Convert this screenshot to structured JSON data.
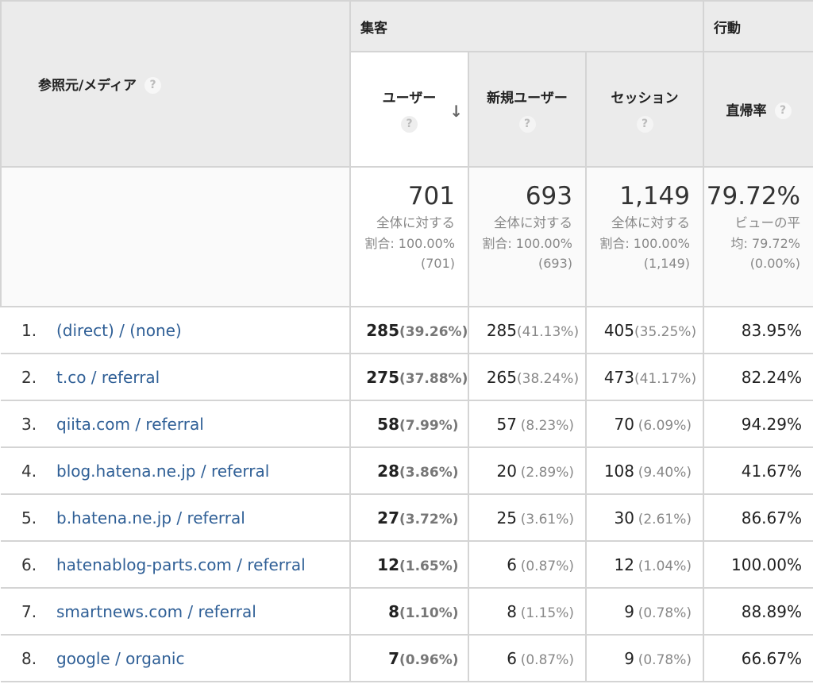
{
  "groups": {
    "acquisition": "集客",
    "behavior": "行動"
  },
  "headers": {
    "dimension": "参照元/メディア",
    "users": "ユーザー",
    "new_users": "新規ユーザー",
    "sessions": "セッション",
    "bounce_rate": "直帰率",
    "help_glyph": "?",
    "sort_glyph": "↓"
  },
  "summary": {
    "users": {
      "total": "701",
      "l1": "全体に対する",
      "l2": "割合: 100.00%",
      "l3": "(701)"
    },
    "new_users": {
      "total": "693",
      "l1": "全体に対する",
      "l2": "割合: 100.00%",
      "l3": "(693)"
    },
    "sessions": {
      "total": "1,149",
      "l1": "全体に対する",
      "l2": "割合: 100.00%",
      "l3": "(1,149)"
    },
    "bounce_rate": {
      "total": "79.72%",
      "l1": "ビューの平",
      "l2": "均: 79.72%",
      "l3": "(0.00%)"
    }
  },
  "rows": [
    {
      "idx": "1.",
      "source": "(direct) / (none)",
      "users": "285",
      "users_pct": "(39.26%)",
      "new_users": "285",
      "new_users_pct": "(41.13%)",
      "sessions": "405",
      "sessions_pct": "(35.25%)",
      "bounce": "83.95%"
    },
    {
      "idx": "2.",
      "source": "t.co / referral",
      "users": "275",
      "users_pct": "(37.88%)",
      "new_users": "265",
      "new_users_pct": "(38.24%)",
      "sessions": "473",
      "sessions_pct": "(41.17%)",
      "bounce": "82.24%"
    },
    {
      "idx": "3.",
      "source": "qiita.com / referral",
      "users": "58",
      "users_pct": "(7.99%)",
      "new_users": "57",
      "new_users_pct": "(8.23%)",
      "sessions": "70",
      "sessions_pct": "(6.09%)",
      "bounce": "94.29%"
    },
    {
      "idx": "4.",
      "source": "blog.hatena.ne.jp / referral",
      "users": "28",
      "users_pct": "(3.86%)",
      "new_users": "20",
      "new_users_pct": "(2.89%)",
      "sessions": "108",
      "sessions_pct": "(9.40%)",
      "bounce": "41.67%"
    },
    {
      "idx": "5.",
      "source": "b.hatena.ne.jp / referral",
      "users": "27",
      "users_pct": "(3.72%)",
      "new_users": "25",
      "new_users_pct": "(3.61%)",
      "sessions": "30",
      "sessions_pct": "(2.61%)",
      "bounce": "86.67%"
    },
    {
      "idx": "6.",
      "source": "hatenablog-parts.com / referral",
      "users": "12",
      "users_pct": "(1.65%)",
      "new_users": "6",
      "new_users_pct": "(0.87%)",
      "sessions": "12",
      "sessions_pct": "(1.04%)",
      "bounce": "100.00%"
    },
    {
      "idx": "7.",
      "source": "smartnews.com / referral",
      "users": "8",
      "users_pct": "(1.10%)",
      "new_users": "8",
      "new_users_pct": "(1.15%)",
      "sessions": "9",
      "sessions_pct": "(0.78%)",
      "bounce": "88.89%"
    },
    {
      "idx": "8.",
      "source": "google / organic",
      "users": "7",
      "users_pct": "(0.96%)",
      "new_users": "6",
      "new_users_pct": "(0.87%)",
      "sessions": "9",
      "sessions_pct": "(0.78%)",
      "bounce": "66.67%"
    }
  ]
}
